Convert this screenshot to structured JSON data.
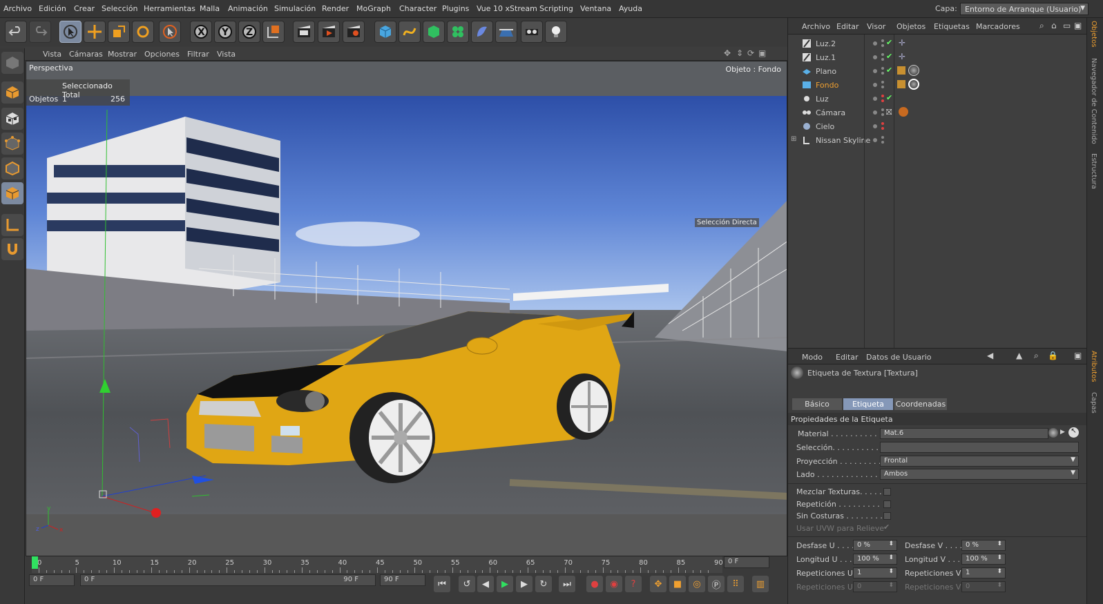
{
  "menu": [
    "Archivo",
    "Edición",
    "Crear",
    "Selección",
    "Herramientas",
    "Malla",
    "Animación",
    "Simulación",
    "Render",
    "MoGraph",
    "Character",
    "Plugins",
    "Vue 10 xStream",
    "Scripting",
    "Ventana",
    "Ayuda"
  ],
  "layer": {
    "label": "Capa:",
    "value": "Entorno de Arranque (Usuario)"
  },
  "toolbar_icons": [
    "undo-icon",
    "redo-icon",
    "select-icon",
    "move-icon",
    "scale-icon",
    "rotate-icon",
    "live-select-icon",
    "x-axis-icon",
    "y-axis-icon",
    "z-axis-icon",
    "coordinate-system-icon",
    "render-view-icon",
    "render-picture-viewer-icon",
    "render-settings-icon",
    "cube-icon",
    "spline-icon",
    "nurbs-icon",
    "array-icon",
    "deformer-icon",
    "floor-icon",
    "camera-icon",
    "light-icon"
  ],
  "axis_letters": {
    "x": "X",
    "y": "Y",
    "z": "Z"
  },
  "viewport": {
    "menu": [
      "Vista",
      "Cámaras",
      "Mostrar",
      "Opciones",
      "Filtrar",
      "Vista"
    ],
    "name": "Perspectiva",
    "object_label": "Objeto : Fondo",
    "stats": {
      "header": "Seleccionado Total",
      "row_label": "Objetos",
      "selected": "1",
      "total": "256"
    },
    "hud_label": "Selección Directa",
    "axis_labels": {
      "y": "y",
      "x": "x",
      "z": "z"
    }
  },
  "object_manager": {
    "menu": [
      "Archivo",
      "Editar",
      "Visor",
      "Objetos",
      "Etiquetas",
      "Marcadores"
    ],
    "objects": [
      {
        "name": "Luz.2",
        "selected": false
      },
      {
        "name": "Luz.1",
        "selected": false
      },
      {
        "name": "Plano",
        "selected": false
      },
      {
        "name": "Fondo",
        "selected": true
      },
      {
        "name": "Luz",
        "selected": false
      },
      {
        "name": "Cámara",
        "selected": false
      },
      {
        "name": "Cielo",
        "selected": false
      },
      {
        "name": "Nissan Skyline",
        "selected": false
      }
    ]
  },
  "side_tabs": [
    "Objetos",
    "Navegador de Contenido",
    "Estructura",
    "Atributos",
    "Capas"
  ],
  "attributes": {
    "menu": [
      "Modo",
      "Editar",
      "Datos de Usuario"
    ],
    "title": "Etiqueta de Textura [Textura]",
    "tabs": [
      "Básico",
      "Etiqueta",
      "Coordenadas"
    ],
    "active_tab": "Etiqueta",
    "section": "Propiedades de la Etiqueta",
    "material_label": "Material . . . . . . . . . . .",
    "material_value": "Mat.6",
    "seleccion_label": "Selección. . . . . . . . . .",
    "proyeccion_label": "Proyección . . . . . . . . .",
    "proyeccion_value": "Frontal",
    "lado_label": "Lado . . . . . . . . . . . . .",
    "lado_value": "Ambos",
    "mezclar_label": "Mezclar Texturas. . . . .",
    "repeticion_label": "Repetición . . . . . . . . .",
    "sincosturas_label": "Sin Costuras . . . . . . . .",
    "uvw_label": "Usar UVW para Relieve",
    "desfase_u_label": "Desfase U . . . .",
    "desfase_u": "0 %",
    "desfase_v_label": "Desfase V . . . .",
    "desfase_v": "0 %",
    "longitud_u_label": "Longitud U . . . .",
    "longitud_u": "100 %",
    "longitud_v_label": "Longitud V . . . .",
    "longitud_v": "100 %",
    "rep_u_label": "Repeticiones U",
    "rep_u": "1",
    "rep_v_label": "Repeticiones V",
    "rep_v": "1",
    "rep_u2_label": "Repeticiones U",
    "rep_u2": "0",
    "rep_v2_label": "Repeticiones V",
    "rep_v2": "0"
  },
  "timeline": {
    "ticks": [
      "0",
      "5",
      "10",
      "15",
      "20",
      "25",
      "30",
      "35",
      "40",
      "45",
      "50",
      "55",
      "60",
      "65",
      "70",
      "75",
      "80",
      "85",
      "90"
    ],
    "current_frame": "0 F",
    "start_frame": "0 F",
    "range_start": "0 F",
    "range_end": "90 F",
    "end_frame": "90 F"
  }
}
